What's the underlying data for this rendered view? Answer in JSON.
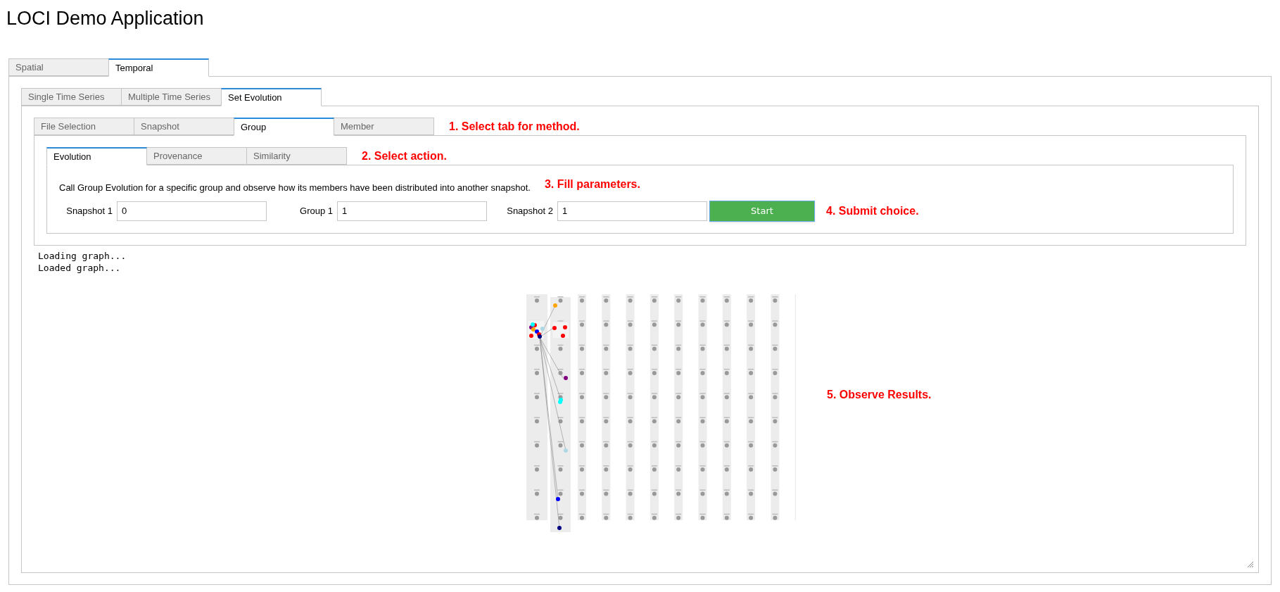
{
  "title": "LOCI Demo Application",
  "main_tabs": [
    {
      "label": "Spatial",
      "selected": false
    },
    {
      "label": "Temporal",
      "selected": true
    }
  ],
  "temporal_tabs": [
    {
      "label": "Single Time Series",
      "selected": false
    },
    {
      "label": "Multiple Time Series",
      "selected": false
    },
    {
      "label": "Set Evolution",
      "selected": true
    }
  ],
  "method_tabs": {
    "tabs": [
      {
        "label": "File Selection",
        "selected": false
      },
      {
        "label": "Snapshot",
        "selected": false
      },
      {
        "label": "Group",
        "selected": true
      },
      {
        "label": "Member",
        "selected": false
      }
    ],
    "hint": "1. Select tab for method."
  },
  "action_tabs": {
    "tabs": [
      {
        "label": "Evolution",
        "selected": true
      },
      {
        "label": "Provenance",
        "selected": false
      },
      {
        "label": "Similarity",
        "selected": false
      }
    ],
    "hint": "2. Select action."
  },
  "form": {
    "description": "Call Group Evolution for a specific group and observe how its members have been distributed into another snapshot.",
    "hint": "3. Fill parameters.",
    "fields": [
      {
        "label": "Snapshot 1",
        "value": "0"
      },
      {
        "label": "Group 1",
        "value": "1"
      },
      {
        "label": "Snapshot 2",
        "value": "1"
      }
    ],
    "button": "Start",
    "submit_hint": "4. Submit choice."
  },
  "log": [
    "Loading graph...",
    "Loaded graph..."
  ],
  "results_hint": "5. Observe Results."
}
